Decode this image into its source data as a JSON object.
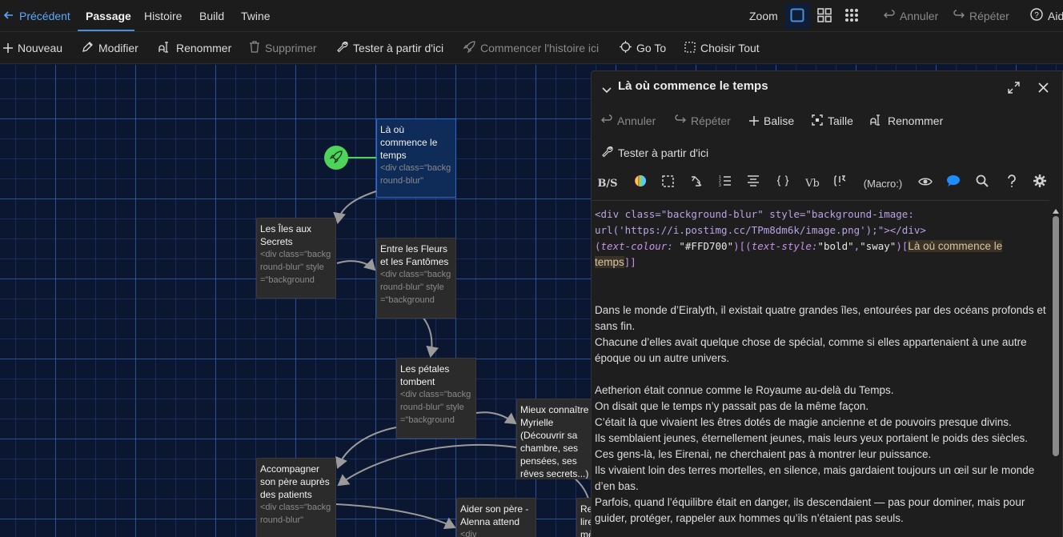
{
  "topbar": {
    "back": "Précédent",
    "tabs": [
      "Passage",
      "Histoire",
      "Build",
      "Twine"
    ],
    "zoom": "Zoom",
    "undo": "Annuler",
    "redo": "Répéter",
    "help": "Aide"
  },
  "toolbar": {
    "new": "Nouveau",
    "edit": "Modifier",
    "rename": "Renommer",
    "delete": "Supprimer",
    "test_from_here": "Tester à partir d'ici",
    "start_story_here": "Commencer l'histoire ici",
    "goto": "Go To",
    "select_all": "Choisir Tout"
  },
  "cards": [
    {
      "title": "Là où commence le temps",
      "excerpt": "<div class=\"background-blur\""
    },
    {
      "title": "Les Îles aux Secrets",
      "excerpt": "<div class=\"background-blur\" style=\"background"
    },
    {
      "title": "Entre les Fleurs et les Fantômes",
      "excerpt": "<div class=\"background-blur\" style=\"background"
    },
    {
      "title": "Les pétales tombent",
      "excerpt": "<div class=\"background-blur\" style=\"background"
    },
    {
      "title": "Mieux connaître Myrielle (Découvrir sa chambre, ses pensées, ses rêves secrets...)",
      "excerpt": ""
    },
    {
      "title": "Accompagner son père auprès des patients",
      "excerpt": "<div class=\"background-blur\""
    },
    {
      "title": "Aider son père - Alenna attend",
      "excerpt": "<div"
    },
    {
      "title": "Re lire mère",
      "excerpt": ""
    }
  ],
  "panel": {
    "title": "Là où commence le temps",
    "undo": "Annuler",
    "redo": "Répéter",
    "tag": "Balise",
    "size": "Taille",
    "rename": "Renommer",
    "test_from_here": "Tester à partir d'ici",
    "format": {
      "bs": "B/S",
      "vb": "Vb",
      "macro": "(Macro:)"
    },
    "code": {
      "l1a": "<div class=\"background-blur\" style=\"background-image:",
      "l1b": "url('https://i.postimg.cc/TPm8dm6k/image.png');\"></div>",
      "m1name": "text-colour:",
      "m1val": "\"#FFD700\"",
      "m2name": "text-style:",
      "m2val1": "\"bold\"",
      "m2val2": "\"sway\"",
      "hook": "Là où commence le temps"
    },
    "prose": [
      "Dans le monde d’Eiralyth, il existait quatre grandes îles, entourées par des océans profonds et sans fin.",
      "Chacune d’elles avait quelque chose de spécial, comme si elles appartenaient à une autre époque ou un autre univers.",
      "",
      "Aetherion était connue comme le Royaume au-delà du Temps.",
      "On disait que le temps n’y passait pas de la même façon.",
      "C’était là que vivaient les êtres dotés de magie ancienne et de pouvoirs presque divins.",
      "Ils semblaient jeunes, éternellement jeunes, mais leurs yeux portaient le poids des siècles.",
      "Ces gens-là, les Eirenai, ne cherchaient pas à montrer leur puissance.",
      "Ils vivaient loin des terres mortelles, en silence, mais gardaient toujours un œil sur le monde d’en bas.",
      "Parfois, quand l’équilibre était en danger, ils descendaient — pas pour dominer, mais pour guider, protéger, rappeler aux hommes qu’ils n’étaient pas seuls."
    ]
  },
  "colors": {
    "accent": "#4a90d9",
    "start_node": "#4ed45a",
    "selected_card": "#0f2b57"
  }
}
